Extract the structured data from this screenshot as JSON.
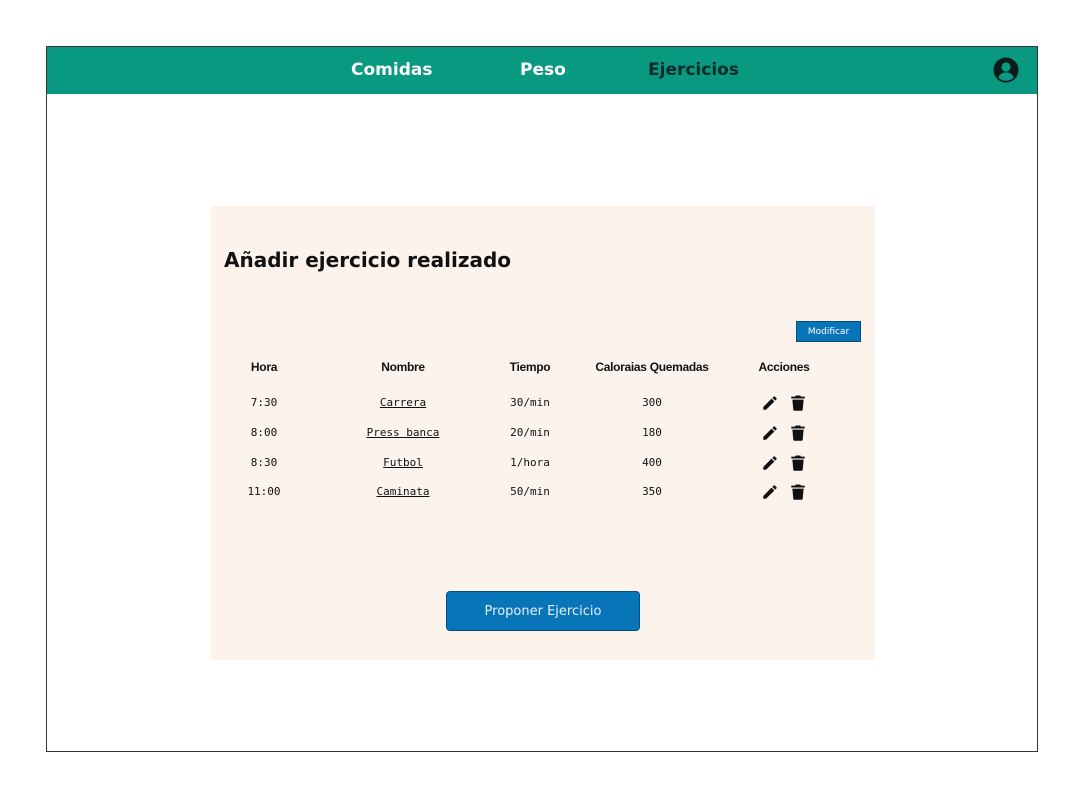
{
  "nav": {
    "items": [
      {
        "label": "Comidas"
      },
      {
        "label": "Peso"
      },
      {
        "label": "Ejercicios"
      }
    ],
    "active": "Ejercicios",
    "color": "#089980",
    "user_icon": "user-circle-icon"
  },
  "card": {
    "title": "Añadir ejercicio realizado",
    "modify_label": "Modificar",
    "background": "#fdf3ed",
    "table": {
      "headers": [
        "Hora",
        "Nombre",
        "Tiempo",
        "Caloraias Quemadas",
        "Acciones"
      ],
      "rows": [
        {
          "hora": "7:30",
          "nombre": "Carrera",
          "tiempo": "30/min",
          "calorias": "300"
        },
        {
          "hora": "8:00",
          "nombre": "Press banca",
          "tiempo": "20/min",
          "calorias": "180"
        },
        {
          "hora": "8:30",
          "nombre": "Futbol",
          "tiempo": "1/hora",
          "calorias": "400"
        },
        {
          "hora": "11:00",
          "nombre": "Caminata",
          "tiempo": "50/min",
          "calorias": "350"
        }
      ],
      "action_icons": [
        "pencil-icon",
        "trash-icon"
      ]
    },
    "propose_label": "Proponer Ejercicio",
    "button_color": "#0875b8"
  }
}
